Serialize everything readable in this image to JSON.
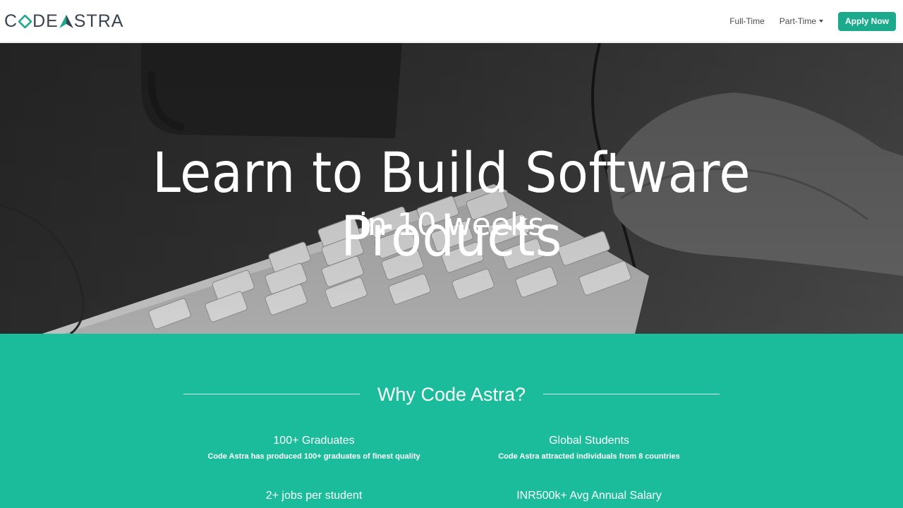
{
  "brand": {
    "part1": "C",
    "part2": "DE ",
    "part3": "STRA",
    "accent": "#1bab8c",
    "dark": "#3a4350"
  },
  "nav": {
    "full_time": "Full-Time",
    "part_time": "Part-Time",
    "apply": "Apply Now"
  },
  "hero": {
    "title": "Learn to Build Software Products",
    "subtitle": "in 10 weeks"
  },
  "why": {
    "title": "Why Code Astra?",
    "bg_color": "#1bbc9b",
    "features": [
      {
        "head": "100+ Graduates",
        "desc": "Code Astra has produced 100+ graduates of finest quality"
      },
      {
        "head": "Global Students",
        "desc": "Code Astra attracted individuals from 8 countries"
      },
      {
        "head": "2+ jobs per student",
        "desc": ""
      },
      {
        "head": "INR500k+ Avg Annual Salary",
        "desc": ""
      }
    ]
  },
  "icons": {
    "diamond": "diamond-logo-icon",
    "astra_a": "triangle-a-logo-icon",
    "caret": "caret-down-icon"
  }
}
